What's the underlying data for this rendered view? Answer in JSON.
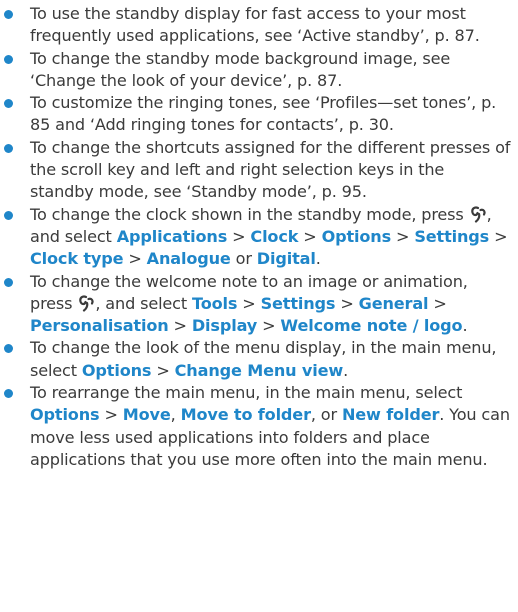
{
  "items": [
    {
      "text": "To use the standby display for fast access to your most frequently used applications, see ‘Active standby’, p. 87."
    },
    {
      "text": "To change the standby mode background image, see ‘Change the look of your device’, p. 87."
    },
    {
      "text": "To customize the ringing tones, see ‘Profiles—set tones’, p. 85 and ‘Add ringing tones for contacts’, p. 30."
    },
    {
      "text": "To change the shortcuts assigned for the different presses of the scroll key and left and right selection keys in the standby mode, see ‘Standby mode’, p. 95."
    },
    {
      "pre": "To change the clock shown in the standby mode, press",
      "mid": ", and select",
      "path": [
        "Applications",
        "Clock",
        "Options",
        "Settings",
        "Clock type",
        "Analogue"
      ],
      "or_text": "or",
      "last": "Digital",
      "end": "."
    },
    {
      "pre": "To change the welcome note to an image or animation, press",
      "mid": ", and select",
      "path": [
        "Tools",
        "Settings",
        "General",
        "Personalisation",
        "Display",
        "Welcome note / logo"
      ],
      "end": "."
    },
    {
      "pre": "To change the look of the menu display, in the main menu, select",
      "path": [
        "Options",
        "Change Menu view"
      ],
      "end": "."
    },
    {
      "pre": "To rearrange the main menu, in the main menu, select",
      "a": "Options",
      "b": "Move",
      "c": "Move to folder",
      "or_text": "or",
      "d": "New folder",
      "end": ". You can move less used applications into folders and place applications that you use more often into the main menu."
    }
  ],
  "separator": ">",
  "icons": {
    "menu_key": "menu-key-icon"
  },
  "colors": {
    "text": "#3b3b3b",
    "accent": "#1f86c9"
  }
}
